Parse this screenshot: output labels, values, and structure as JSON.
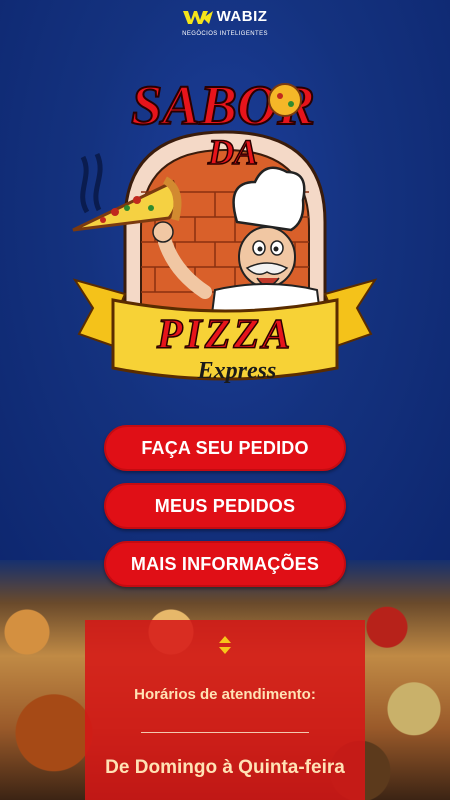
{
  "brand": {
    "name": "WABIZ",
    "tagline": "NEGÓCIOS INTELIGENTES",
    "icon": "wabiz-logo-icon"
  },
  "logo": {
    "line1": "SABOR",
    "line2": "DA",
    "line3": "PIZZA",
    "line4": "Express",
    "icon": "chef-pizza-mascot"
  },
  "menu": {
    "order_label": "FAÇA SEU PEDIDO",
    "my_orders_label": "MEUS PEDIDOS",
    "more_info_label": "MAIS INFORMAÇÕES"
  },
  "info": {
    "toggle_icon": "expand-collapse-arrows-icon",
    "hours_label": "Horários de atendimento:",
    "days": "De Domingo à Quinta-feira"
  },
  "colors": {
    "background": "#0e2a78",
    "button": "#e00f16",
    "panel": "#d61616",
    "panel_text": "#ffe2b5"
  }
}
